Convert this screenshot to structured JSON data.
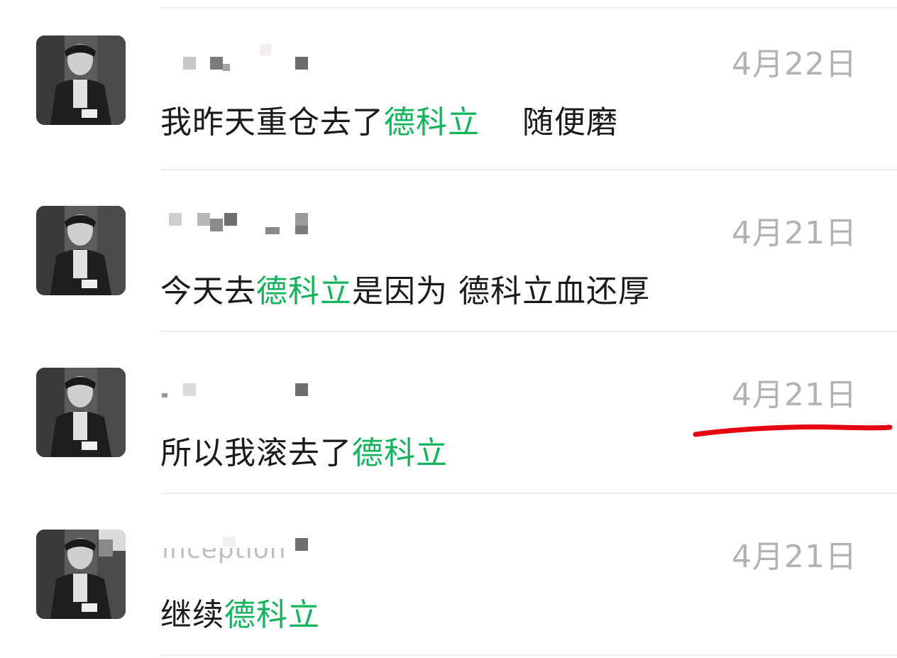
{
  "messages": [
    {
      "date": "4月22日",
      "segments": [
        {
          "text": "我昨天重仓去了",
          "highlight": false
        },
        {
          "text": "德科立",
          "highlight": true
        },
        {
          "text": "    随便磨",
          "highlight": false
        }
      ]
    },
    {
      "date": "4月21日",
      "segments": [
        {
          "text": "今天去",
          "highlight": false
        },
        {
          "text": "德科立",
          "highlight": true
        },
        {
          "text": "是因为 德科立血还厚",
          "highlight": false
        }
      ]
    },
    {
      "date": "4月21日",
      "segments": [
        {
          "text": "所以我滚去了",
          "highlight": false
        },
        {
          "text": "德科立",
          "highlight": true
        }
      ]
    },
    {
      "date": "4月21日",
      "name_partial": "inception",
      "segments": [
        {
          "text": "继续",
          "highlight": false
        },
        {
          "text": "德科立",
          "highlight": true
        }
      ]
    }
  ],
  "colors": {
    "highlight": "#12b35a",
    "date": "#b2b2b2",
    "text": "#1a1a1a",
    "annotation": "#e60012"
  }
}
